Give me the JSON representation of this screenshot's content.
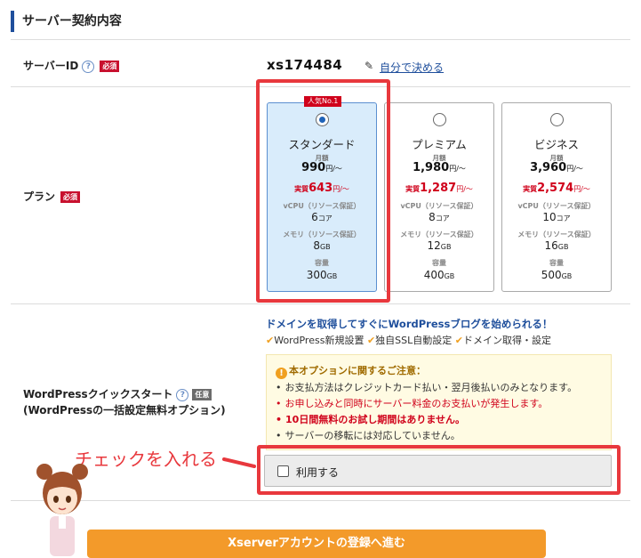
{
  "section": {
    "title": "サーバー契約内容"
  },
  "server_id": {
    "label": "サーバーID",
    "required": "必須",
    "value": "xs174484",
    "link": "自分で決める"
  },
  "plan": {
    "label": "プラン",
    "required": "必須",
    "popular": "人気No.1",
    "monthly_label": "月額",
    "real_prefix": "実質",
    "price_unit": "円/〜",
    "vcpu_label": "vCPU（リソース保証）",
    "memory_label": "メモリ（リソース保証）",
    "storage_label": "容量",
    "core_unit": "コア",
    "gb_unit": "GB",
    "cards": [
      {
        "name": "スタンダード",
        "price": "990",
        "real": "643",
        "vcpu": "6",
        "memory": "8",
        "storage": "300",
        "selected": true
      },
      {
        "name": "プレミアム",
        "price": "1,980",
        "real": "1,287",
        "vcpu": "8",
        "memory": "12",
        "storage": "400",
        "selected": false
      },
      {
        "name": "ビジネス",
        "price": "3,960",
        "real": "2,574",
        "vcpu": "10",
        "memory": "16",
        "storage": "500",
        "selected": false
      }
    ]
  },
  "wordpress": {
    "label_line1": "WordPressクイックスタート",
    "label_line2": "(WordPressの一括設定無料オプション)",
    "optional": "任意",
    "headline": "ドメインを取得してすぐにWordPressブログを始められる！",
    "features": [
      "WordPress新規設置",
      "独自SSL自動設定",
      "ドメイン取得・設定"
    ],
    "notice_title": "本オプションに関するご注意：",
    "notices": [
      "お支払方法はクレジットカード払い・翌月後払いのみとなります。",
      "お申し込みと同時にサーバー料金のお支払いが発生します。",
      "10日間無料のお試し期間はありません。",
      "サーバーの移転には対応していません。"
    ],
    "use_label": "利用する",
    "checked": false
  },
  "annotation": {
    "callout": "チェックを入れる"
  },
  "submit": {
    "label": "Xserverアカウントの登録へ進む"
  },
  "colors": {
    "accent": "#1f4f9c",
    "red": "#d0021b",
    "highlight": "#e8383d",
    "button": "#f39a2a"
  }
}
